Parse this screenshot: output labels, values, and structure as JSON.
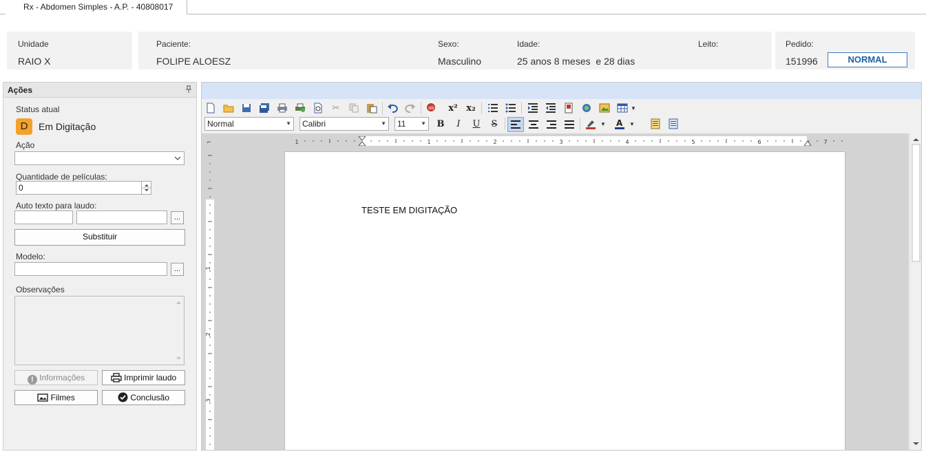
{
  "tab": {
    "title": "Rx - Abdomen Simples - A.P. - 40808017"
  },
  "header": {
    "unidade_label": "Unidade",
    "unidade_value": "RAIO X",
    "paciente_label": "Paciente:",
    "paciente_value": "FOLIPE ALOESZ",
    "sexo_label": "Sexo:",
    "sexo_value": "Masculino",
    "idade_label": "Idade:",
    "idade_value": "25 anos 8 meses  e 28 dias",
    "leito_label": "Leito:",
    "pedido_label": "Pedido:",
    "pedido_value": "151996",
    "status_badge": "NORMAL"
  },
  "actions_panel": {
    "title": "Ações",
    "status_atual_label": "Status atual",
    "status_letter": "D",
    "status_text": "Em Digitação",
    "acao_label": "Ação",
    "acao_value": "",
    "qtd_label": "Quantidade de películas:",
    "qtd_value": "0",
    "auto_texto_label": "Auto texto para laudo:",
    "ellipsis": "...",
    "substituir_label": "Substituir",
    "modelo_label": "Modelo:",
    "observacoes_label": "Observações",
    "informacoes_label": "Informações",
    "imprimir_label": "Imprimir laudo",
    "filmes_label": "Filmes",
    "conclusao_label": "Conclusão"
  },
  "editor": {
    "style_value": "Normal",
    "font_value": "Calibri",
    "size_value": "11",
    "ruler_numbers": [
      "1",
      "1",
      "2",
      "3",
      "4",
      "5",
      "6",
      "7"
    ],
    "vruler_numbers": [
      "1",
      "2",
      "3"
    ],
    "document_text": "TESTE EM DIGITAÇÃO"
  },
  "colors": {
    "status_badge_border": "#3a7ab8",
    "status_letter_bg": "#f4a22b",
    "editor_header": "#d7e3f6"
  }
}
